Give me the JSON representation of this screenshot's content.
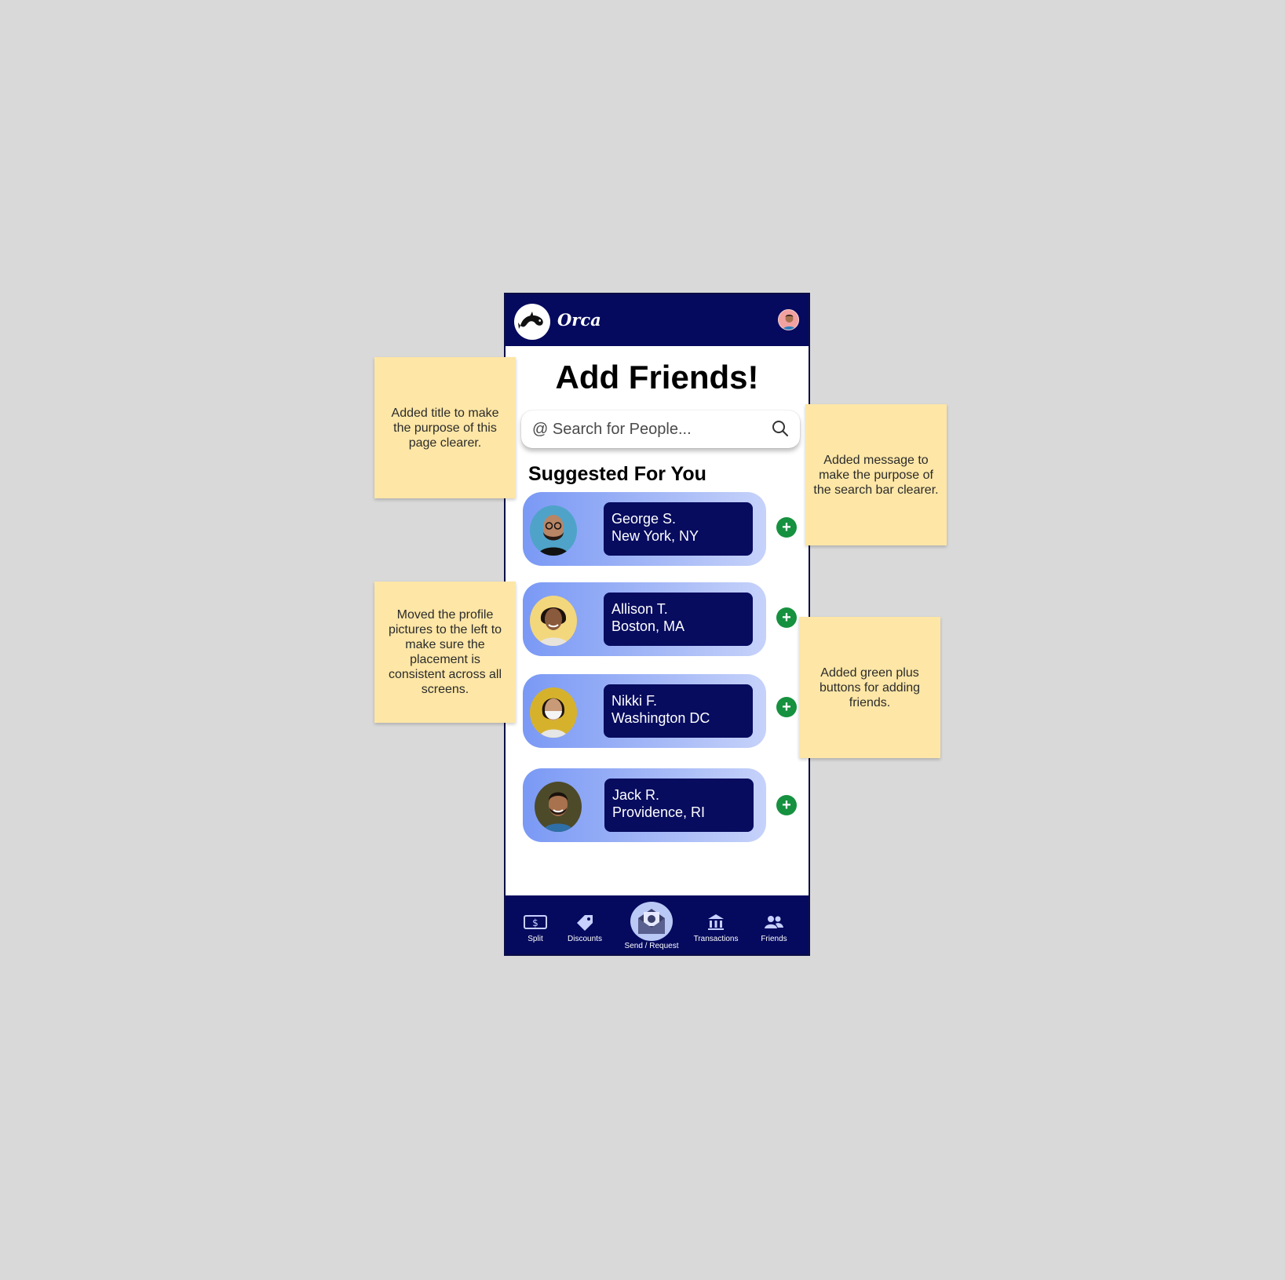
{
  "app": {
    "name": "Orca"
  },
  "page": {
    "title": "Add Friends!",
    "section_title": "Suggested For You"
  },
  "search": {
    "placeholder": "@ Search for People..."
  },
  "friends": [
    {
      "name": "George S.",
      "location": "New York, NY",
      "photo_bg": "#4fa3c9",
      "skin": "#b88565",
      "hair": "#2a1a12"
    },
    {
      "name": "Allison T.",
      "location": "Boston, MA",
      "photo_bg": "#f3d77c",
      "skin": "#8a5a3c",
      "hair": "#1c120c"
    },
    {
      "name": "Nikki F.",
      "location": "Washington DC",
      "photo_bg": "#d6b22c",
      "skin": "#c89a78",
      "hair": "#1e140e"
    },
    {
      "name": "Jack R.",
      "location": "Providence, RI",
      "photo_bg": "#4d4a2a",
      "skin": "#a8724e",
      "hair": "#1a120c"
    }
  ],
  "add_button": {
    "symbol": "+",
    "color": "#16913f"
  },
  "nav": {
    "items": [
      {
        "label": "Split",
        "icon": "split-money-icon"
      },
      {
        "label": "Discounts",
        "icon": "tag-icon"
      },
      {
        "label": "Send / Request",
        "icon": "envelope-money-icon"
      },
      {
        "label": "Transactions",
        "icon": "bank-icon"
      },
      {
        "label": "Friends",
        "icon": "people-icon"
      }
    ]
  },
  "notes": [
    "Added title to make the purpose of this page clearer.",
    "Added message to make the purpose of the search bar clearer.",
    "Moved the profile pictures to the left to make sure the placement is consistent across all screens.",
    "Added green plus buttons for adding friends."
  ],
  "colors": {
    "navy": "#050a5e",
    "card_gradient_start": "#7a99f5",
    "card_gradient_end": "#c6d2fa",
    "note_yellow": "#fde6a6",
    "canvas": "#d9d9d9"
  }
}
